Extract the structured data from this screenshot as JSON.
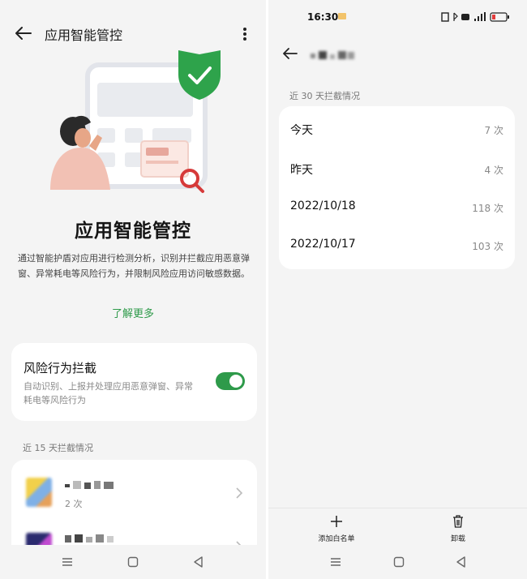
{
  "left_screen": {
    "header": {
      "title": "应用智能管控"
    },
    "hero": {
      "title": "应用智能管控",
      "description": "通过智能护盾对应用进行检测分析，识别并拦截应用恶意弹窗、异常耗电等风险行为，并限制风险应用访问敏感数据。",
      "learn_more": "了解更多"
    },
    "risk_block": {
      "title": "风险行为拦截",
      "description": "自动识别、上报并处理应用恶意弹窗、异常耗电等风险行为",
      "enabled": true
    },
    "section_title": "近 15 天拦截情况",
    "apps": [
      {
        "name": "▪▫▪▪▫",
        "count": "2 次",
        "icon_colors": [
          "#f2d04a",
          "#7fb0e6",
          "#e6a15a"
        ]
      },
      {
        "name": "▪▪▫▪▫",
        "count": "",
        "icon_colors": [
          "#2a2a6e",
          "#c04ad0",
          "#3a9de0"
        ]
      }
    ]
  },
  "right_screen": {
    "status_bar": {
      "time": "16:30"
    },
    "header": {
      "title": "▪▫▪▫▪"
    },
    "section_title": "近 30 天拦截情况",
    "stats": [
      {
        "label": "今天",
        "value": "7 次"
      },
      {
        "label": "昨天",
        "value": "4 次"
      },
      {
        "label": "2022/10/18",
        "value": "118 次"
      },
      {
        "label": "2022/10/17",
        "value": "103 次"
      }
    ],
    "actions": [
      {
        "label": "添加白名单",
        "icon": "plus-icon"
      },
      {
        "label": "卸载",
        "icon": "trash-icon"
      }
    ]
  },
  "colors": {
    "accent_green": "#2e9a4a",
    "background": "#f4f4f4",
    "card": "#ffffff"
  }
}
